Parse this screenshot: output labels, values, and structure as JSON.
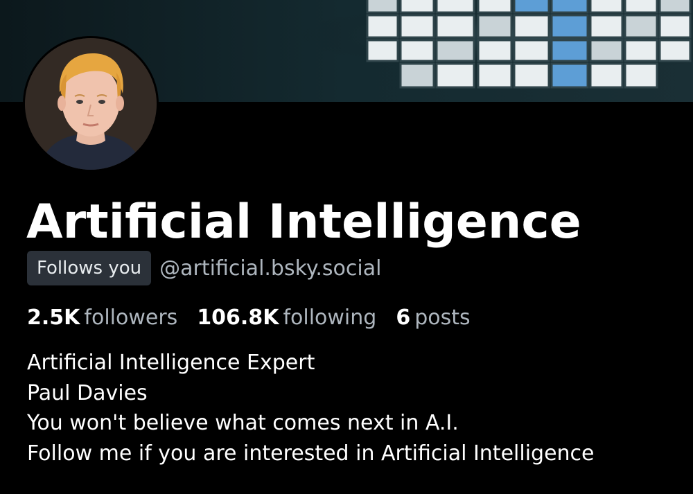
{
  "profile": {
    "display_name": "Artificial Intelligence",
    "follows_badge": "Follows you",
    "handle": "@artificial.bsky.social",
    "stats": {
      "followers_count": "2.5K",
      "followers_label": "followers",
      "following_count": "106.8K",
      "following_label": "following",
      "posts_count": "6",
      "posts_label": "posts"
    },
    "bio_lines": [
      "Artificial Intelligence Expert",
      "Paul Davies",
      "You won't believe what comes next in A.I.",
      "Follow me if you are interested in Artificial Intelligence"
    ]
  },
  "colors": {
    "background": "#000000",
    "text": "#ffffff",
    "muted_text": "#aeb6be",
    "badge_bg": "#2b3139"
  }
}
